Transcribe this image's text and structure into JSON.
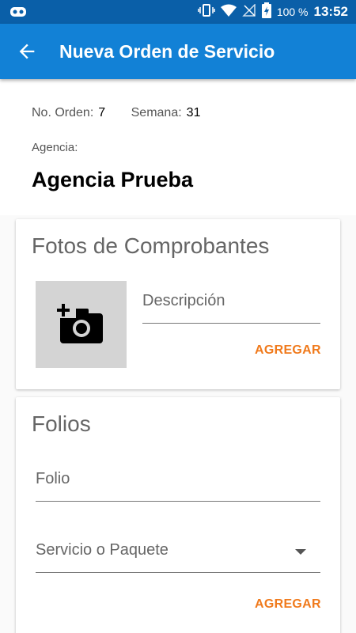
{
  "status_bar": {
    "battery_percent": "100 %",
    "time": "13:52"
  },
  "app_bar": {
    "title": "Nueva Orden de Servicio"
  },
  "orden": {
    "numero_label": "No. Orden:",
    "numero_value": "7",
    "semana_label": "Semana:",
    "semana_value": "31",
    "agencia_label": "Agencia:",
    "agencia_name": "Agencia Prueba"
  },
  "fotos": {
    "title": "Fotos de Comprobantes",
    "descripcion_placeholder": "Descripción",
    "agregar_label": "AGREGAR"
  },
  "folios": {
    "title": "Folios",
    "folio_placeholder": "Folio",
    "servicio_placeholder": "Servicio o Paquete",
    "agregar_label": "AGREGAR"
  },
  "colors": {
    "app_bar": "#1281d6",
    "status_bar": "#0a5fa8",
    "accent": "#f07a1c"
  }
}
